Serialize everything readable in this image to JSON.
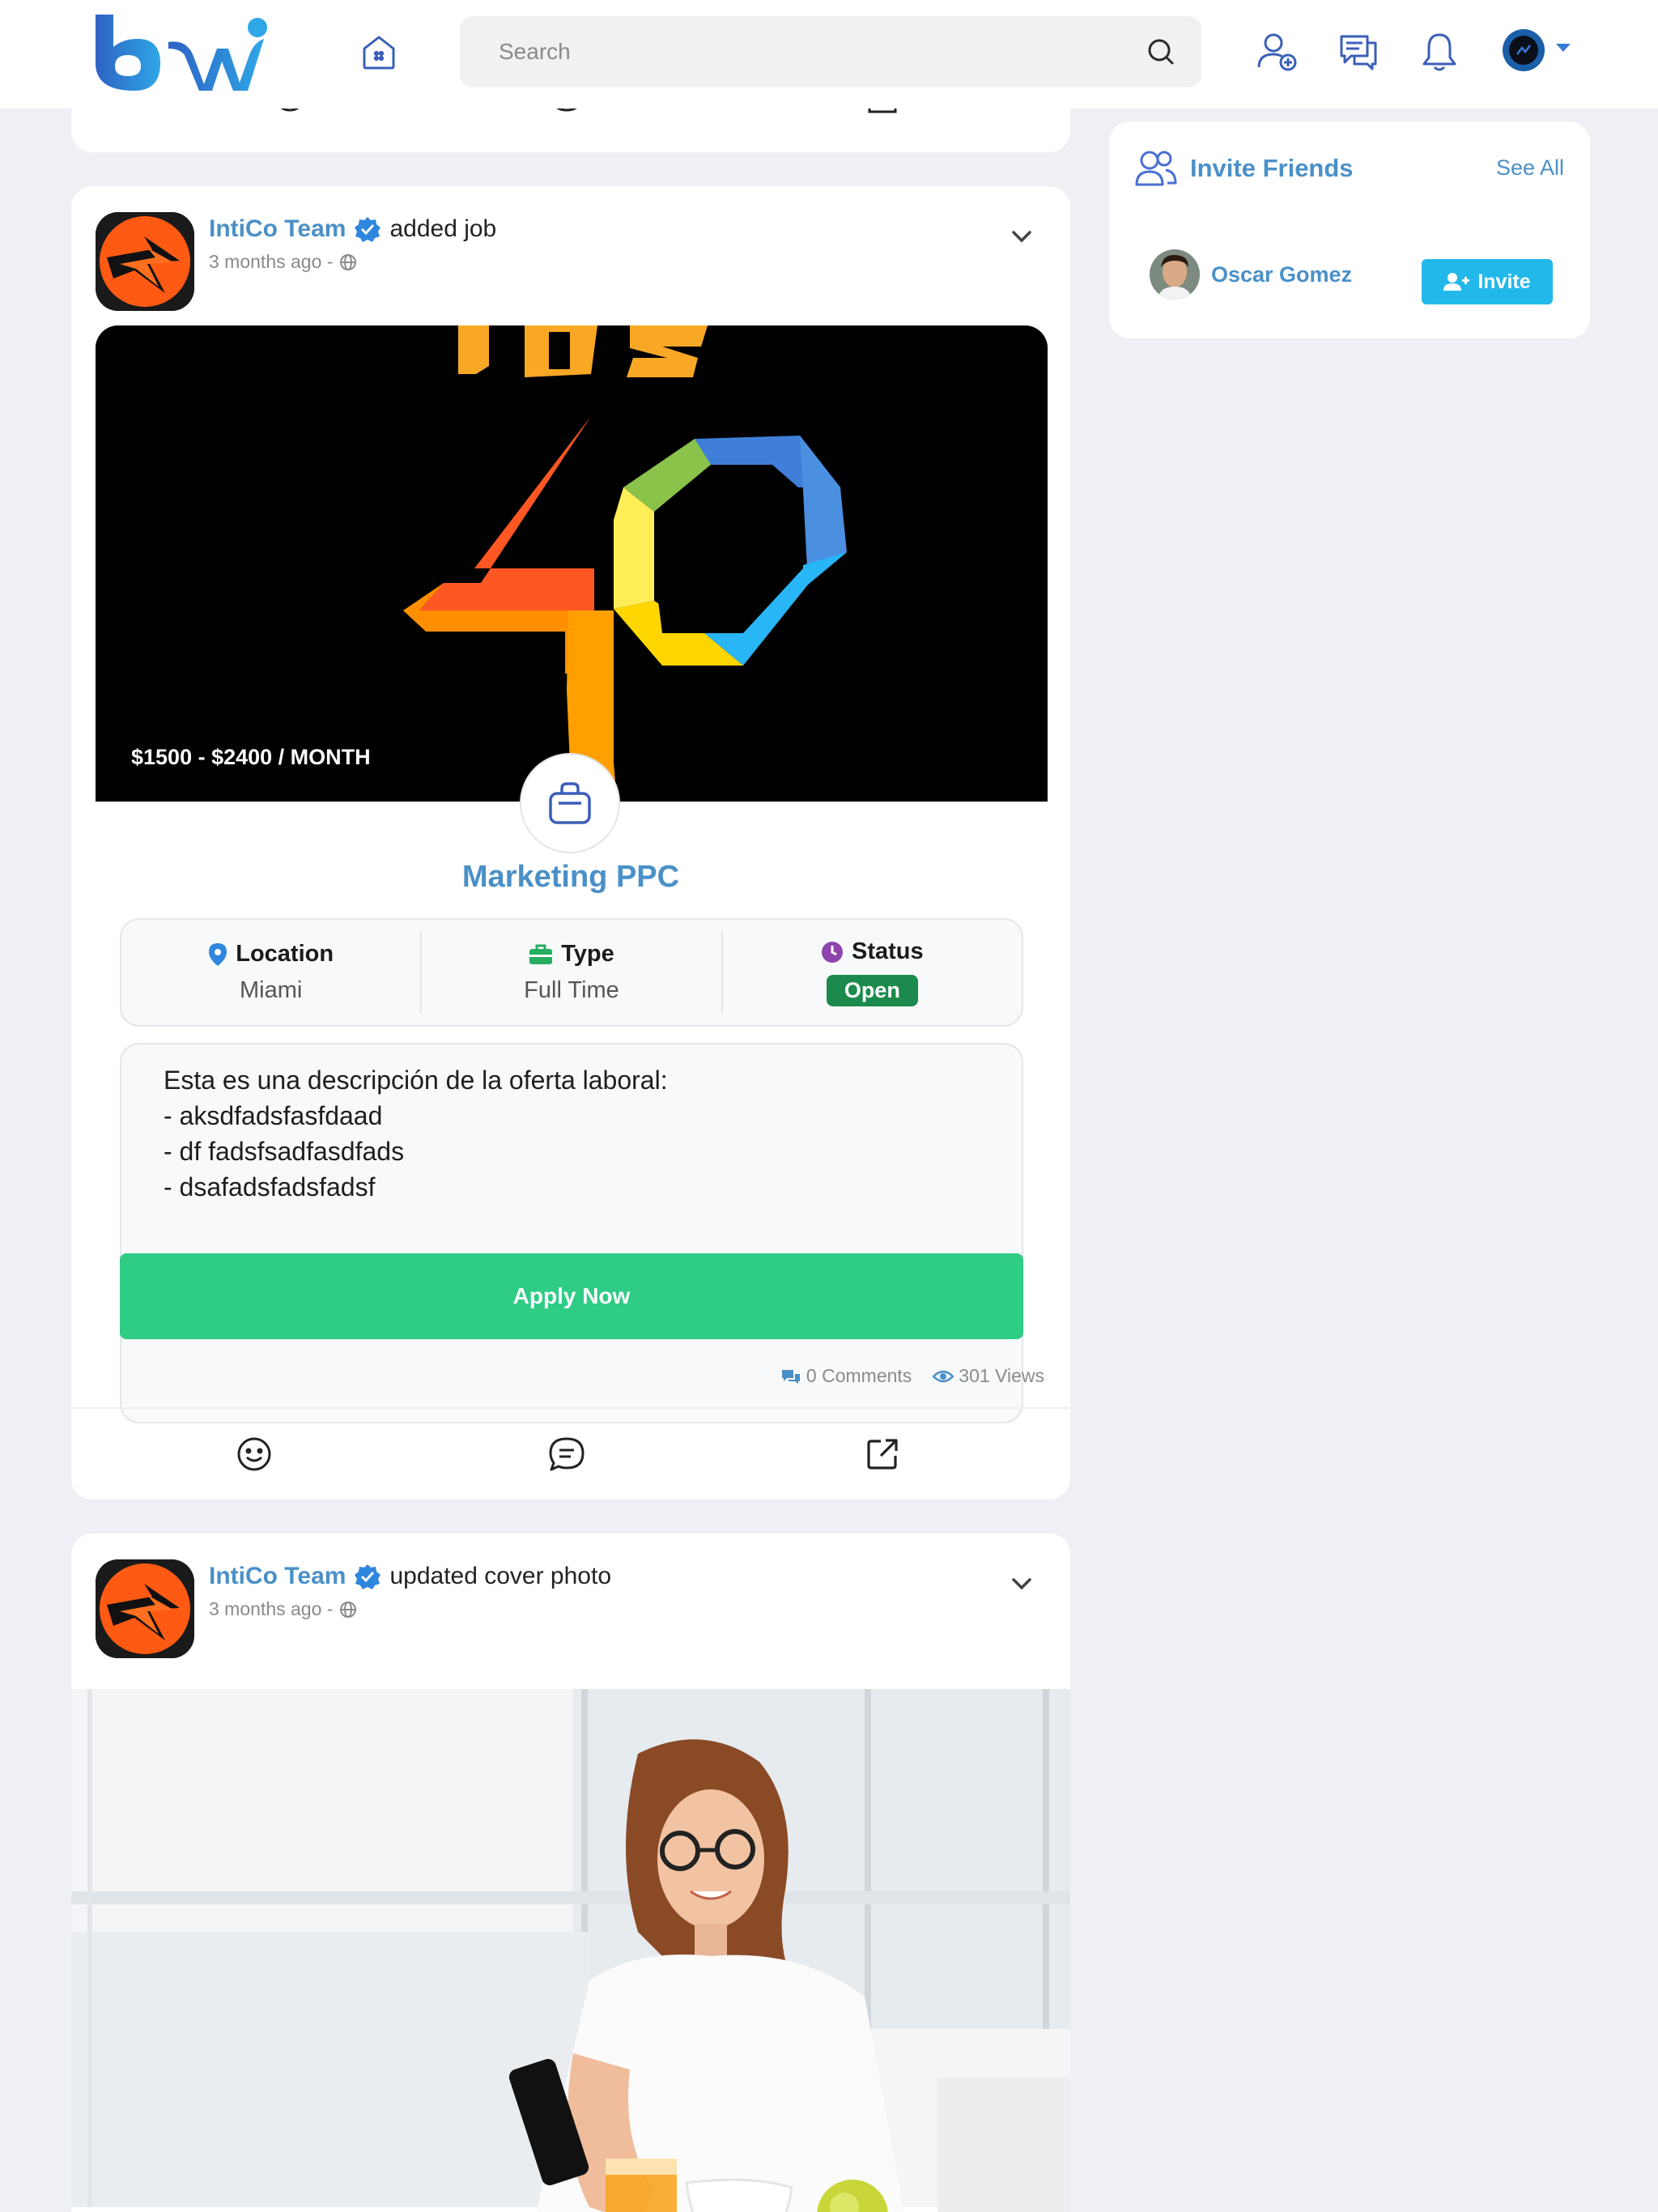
{
  "header": {
    "search_placeholder": "Search"
  },
  "invite_friends": {
    "title": "Invite Friends",
    "see_all": "See All",
    "friends": [
      {
        "name": "Oscar Gomez",
        "button": "Invite"
      }
    ]
  },
  "posts": [
    {
      "author": "IntiCo Team",
      "action": "added job",
      "time": "3 months ago -",
      "job": {
        "salary": "$1500 - $2400 / MONTH",
        "title": "Marketing PPC",
        "location_label": "Location",
        "location_value": "Miami",
        "type_label": "Type",
        "type_value": "Full Time",
        "status_label": "Status",
        "status_value": "Open",
        "description": [
          "Esta es una descripción de la oferta laboral:",
          "- aksdfadsfasfdaad",
          "- df fadsfsadfasdfads",
          "- dsafadsfadsfadsf"
        ],
        "apply_label": "Apply Now"
      },
      "comments": "0 Comments",
      "views": "301 Views"
    },
    {
      "author": "IntiCo Team",
      "action": "updated cover photo",
      "time": "3 months ago -"
    }
  ],
  "colors": {
    "accent": "#4a90c8",
    "apply_green": "#2ecc85",
    "status_green": "#1b8a4c",
    "invite_blue": "#22b8ea",
    "background": "#eef0f5"
  }
}
